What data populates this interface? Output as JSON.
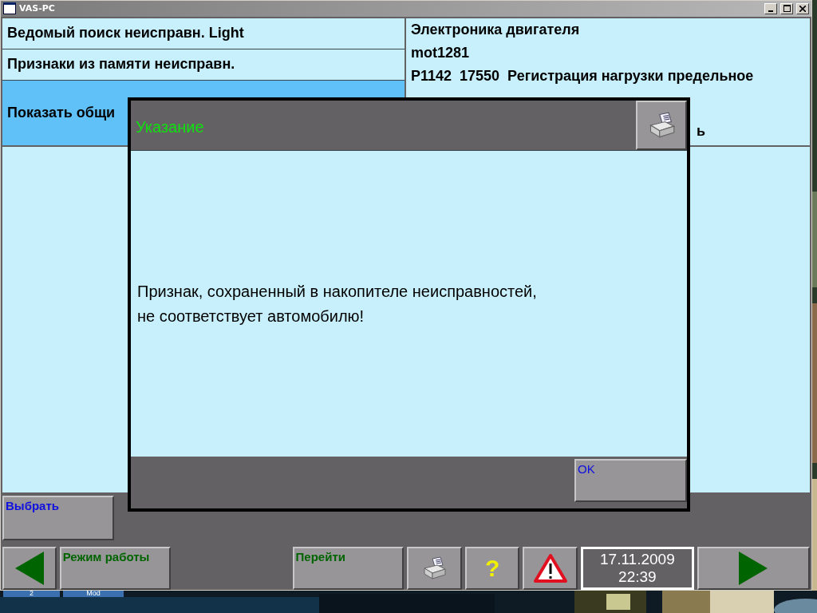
{
  "window": {
    "title": "VAS-PC"
  },
  "menu": [
    {
      "label": "Ведомый поиск неисправн. Light",
      "selected": false
    },
    {
      "label": "Признаки из памяти неисправн.",
      "selected": false
    },
    {
      "label": "Показать общи",
      "selected": true
    }
  ],
  "info": {
    "lines": [
      "Электроника двигателя",
      "mot1281",
      "P1142  17550  Регистрация нагрузки предельное"
    ],
    "fragment": "ь"
  },
  "select_button": {
    "label": "Выбрать"
  },
  "toolbar": [
    {
      "kind": "back"
    },
    {
      "kind": "text",
      "label": "Режим работы"
    },
    {
      "kind": "text",
      "label": "Перейти"
    },
    {
      "kind": "print"
    },
    {
      "kind": "help",
      "label": "?"
    },
    {
      "kind": "warning"
    },
    {
      "kind": "clock",
      "date": "17.11.2009",
      "time": "22:39"
    },
    {
      "kind": "forward"
    }
  ],
  "taskbar": [
    {
      "label": "2"
    },
    {
      "label": "Mod"
    }
  ],
  "dialog": {
    "title": "Указание",
    "message": "Признак, сохраненный в накопителе неисправностей,\nне соответствует автомобилю!",
    "buttons": [
      "OK"
    ]
  }
}
